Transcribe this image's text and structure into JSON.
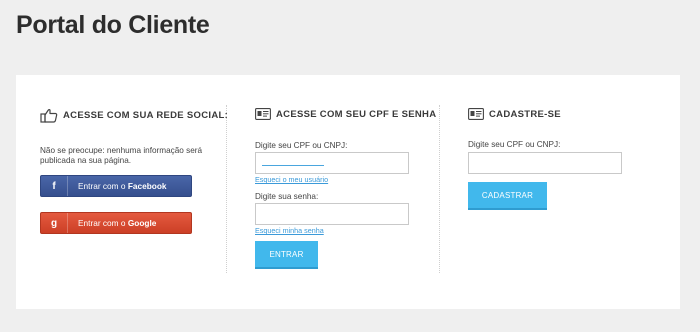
{
  "page": {
    "title": "Portal do Cliente"
  },
  "social": {
    "heading": "ACESSE COM SUA REDE SOCIAL:",
    "heading_icon": "thumbs-up-icon",
    "note": "Não se preocupe: nenhuma informação será publicada na sua página.",
    "facebook": {
      "icon": "facebook-icon",
      "icon_glyph": "f",
      "label_prefix": "Entrar com o ",
      "label_brand": "Facebook",
      "color": "#3b5998"
    },
    "google": {
      "icon": "google-icon",
      "icon_glyph": "g",
      "label_prefix": "Entrar com o ",
      "label_brand": "Google",
      "color": "#dd4b39"
    }
  },
  "login": {
    "heading": "ACESSE COM SEU CPF E SENHA",
    "heading_icon": "id-card-icon",
    "cpf_label": "Digite seu CPF ou CNPJ:",
    "cpf_value": "",
    "forgot_user": "Esqueci o meu usuário",
    "password_label": "Digite sua senha:",
    "password_value": "",
    "forgot_password": "Esqueci minha senha",
    "submit": "ENTRAR"
  },
  "register": {
    "heading": "CADASTRE-SE",
    "heading_icon": "id-card-icon",
    "cpf_label": "Digite seu CPF ou CNPJ:",
    "cpf_value": "",
    "submit": "CADASTRAR"
  },
  "colors": {
    "accent": "#41b8ec",
    "link": "#3b9ad9",
    "background": "#efefef",
    "panel": "#ffffff"
  }
}
